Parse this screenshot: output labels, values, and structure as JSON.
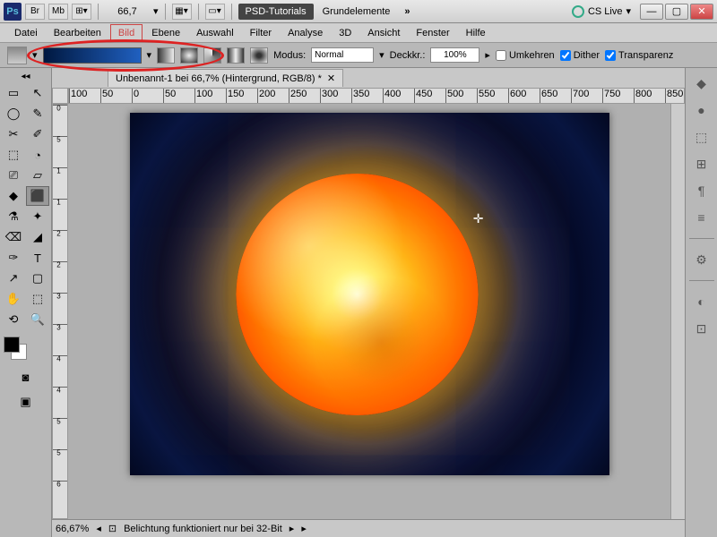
{
  "titlebar": {
    "logo": "Ps",
    "zoom": "66,7",
    "tab_active": "PSD-Tutorials",
    "tab_label": "Grundelemente",
    "cs_live": "CS Live"
  },
  "menu": [
    "Datei",
    "Bearbeiten",
    "Bild",
    "Ebene",
    "Auswahl",
    "Filter",
    "Analyse",
    "3D",
    "Ansicht",
    "Fenster",
    "Hilfe"
  ],
  "options": {
    "mode_label": "Modus:",
    "mode_value": "Normal",
    "opacity_label": "Deckkr.:",
    "opacity_value": "100%",
    "reverse": "Umkehren",
    "dither": "Dither",
    "transparency": "Transparenz"
  },
  "document": {
    "tab_title": "Unbenannt-1 bei 66,7% (Hintergrund, RGB/8) *"
  },
  "ruler_h": [
    "100",
    "50",
    "0",
    "50",
    "100",
    "150",
    "200",
    "250",
    "300",
    "350",
    "400",
    "450",
    "500",
    "550",
    "600",
    "650",
    "700",
    "750",
    "800",
    "850"
  ],
  "ruler_v": [
    "0",
    "5",
    "1",
    "1",
    "2",
    "2",
    "3",
    "3",
    "4",
    "4",
    "5",
    "5",
    "6"
  ],
  "status": {
    "zoom": "66,67%",
    "message": "Belichtung funktioniert nur bei 32-Bit"
  },
  "tool_icons": [
    "▭",
    "↖",
    "◯",
    "✎",
    "✂",
    "✐",
    "⬚",
    "◔",
    "⎚",
    "▱",
    "◆",
    "⬛",
    "⚗",
    "✦",
    "⌫",
    "◢",
    "✑",
    "T",
    "↗",
    "▢",
    "✋",
    "⬚",
    "⟲",
    "🔍"
  ],
  "panel_icons": [
    "◆",
    "●",
    "⬚",
    "⊞",
    "¶",
    "≡",
    "⚙",
    "◐",
    "⊡"
  ]
}
